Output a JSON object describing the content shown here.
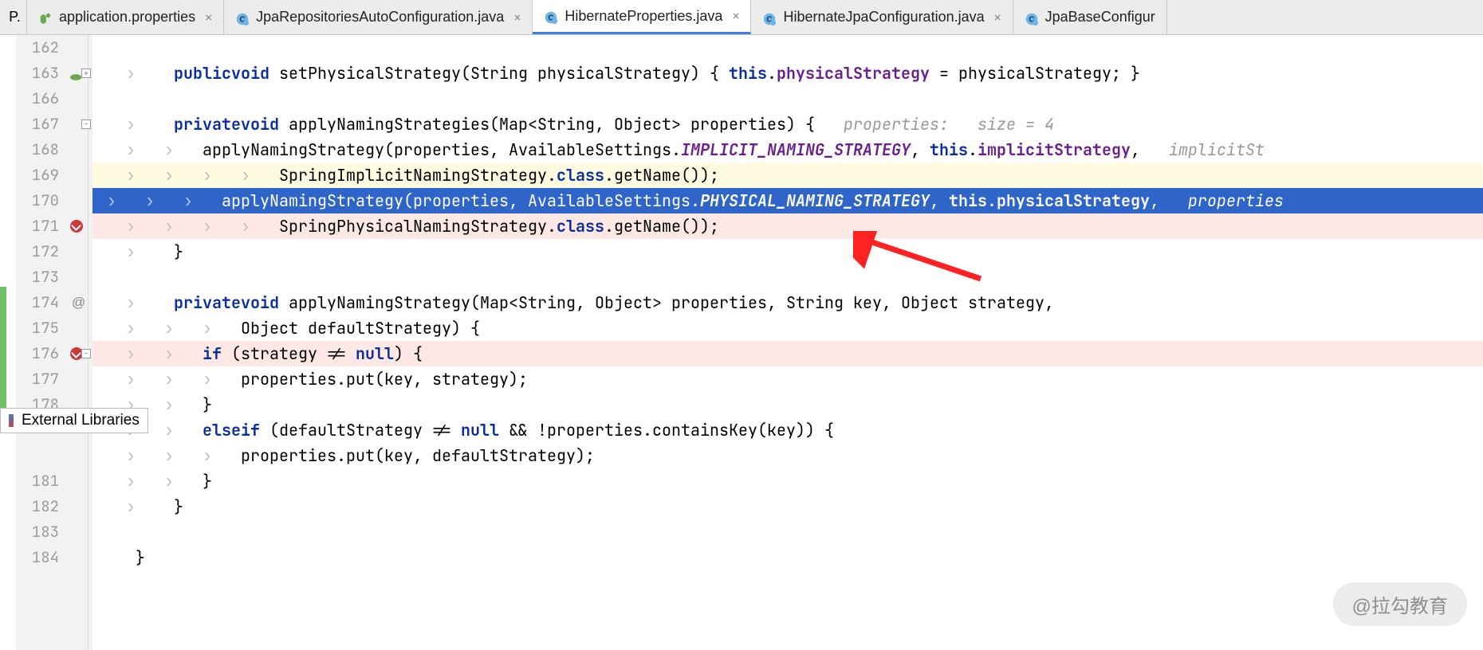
{
  "prefix": "P.",
  "tabs": [
    {
      "label": "application.properties",
      "icon": "props",
      "active": false
    },
    {
      "label": "JpaRepositoriesAutoConfiguration.java",
      "icon": "class",
      "active": false
    },
    {
      "label": "HibernateProperties.java",
      "icon": "class",
      "active": true
    },
    {
      "label": "HibernateJpaConfiguration.java",
      "icon": "class",
      "active": false
    },
    {
      "label": "JpaBaseConfigur",
      "icon": "class",
      "active": false,
      "truncated": true
    }
  ],
  "external_libraries_label": "External Libraries",
  "watermark": "@拉勾教育",
  "gutter_lines": [
    "162",
    "163",
    "166",
    "167",
    "168",
    "169",
    "170",
    "171",
    "172",
    "173",
    "174",
    "175",
    "176",
    "177",
    "178",
    "",
    "",
    "181",
    "182",
    "183",
    "184"
  ],
  "gutter_marks": {
    "1": "spring-fold",
    "3": "fold-open",
    "7": "breakpoint",
    "10": "at",
    "12": "breakpoint-fold"
  },
  "code_lines": [
    {
      "cls": "",
      "html": ""
    },
    {
      "cls": "",
      "html": "<span class='chev'>   ›    </span><span class='kw'>public</span> <span class='kw'>void</span> setPhysicalStrategy(String physicalStrategy) { <span class='kw'>this</span>.<span class='field'>physicalStrategy</span> = physicalStrategy; }"
    },
    {
      "cls": "",
      "html": ""
    },
    {
      "cls": "",
      "html": "<span class='chev'>   ›    </span><span class='kw'>private</span> <span class='kw'>void</span> applyNamingStrategies(Map&lt;String, Object&gt; properties) {   <span class='hint'>properties:   size = 4</span>"
    },
    {
      "cls": "",
      "html": "<span class='chev'>   ›   ›   </span>applyNamingStrategy(properties, AvailableSettings.<span class='const'>IMPLICIT_NAMING_STRATEGY</span>, <span class='kw'>this</span>.<span class='field'>implicitStrategy</span>,   <span class='hint'>implicitSt</span>"
    },
    {
      "cls": "hl-yellow",
      "html": "<span class='chev'>   ›   ›   ›   ›   </span>SpringImplicitNamingStrategy.<span class='kw'>class</span>.getName());"
    },
    {
      "cls": "sel",
      "html": "<span class='chev'> ›   ›   ›   </span>applyNamingStrategy(properties, AvailableSettings.<span class='const'>PHYSICAL_NAMING_STRATEGY</span>, <span class='kw'>this</span>.<span class='field'>physicalStrategy</span>,   <span class='hint'>properties</span>"
    },
    {
      "cls": "hl-pink",
      "html": "<span class='chev'>   ›   ›   ›   ›   </span>SpringPhysicalNamingStrategy.<span class='kw'>class</span>.getName());"
    },
    {
      "cls": "",
      "html": "<span class='chev'>   ›    </span>}"
    },
    {
      "cls": "",
      "html": ""
    },
    {
      "cls": "",
      "html": "<span class='chev'>   ›    </span><span class='kw'>private</span> <span class='kw'>void</span> applyNamingStrategy(Map&lt;String, Object&gt; properties, String key, Object strategy,"
    },
    {
      "cls": "",
      "html": "<span class='chev'>   ›   ›   ›   </span>Object defaultStrategy) {"
    },
    {
      "cls": "hl-pink",
      "html": "<span class='chev'>   ›   ›   </span><span class='kw'>if</span> (strategy != <span class='kw'>null</span>) {"
    },
    {
      "cls": "",
      "html": "<span class='chev'>   ›   ›   ›   </span>properties.put(key, strategy);"
    },
    {
      "cls": "",
      "html": "<span class='chev'>   ›   ›   </span>}"
    },
    {
      "cls": "",
      "html": "<span class='chev'>   ›   ›   </span><span class='kw'>else</span> <span class='kw'>if</span> (defaultStrategy != <span class='kw'>null</span> && !properties.containsKey(key)) {"
    },
    {
      "cls": "",
      "html": "<span class='chev'>   ›   ›   ›   </span>properties.put(key, defaultStrategy);"
    },
    {
      "cls": "",
      "html": "<span class='chev'>   ›   ›   </span>}"
    },
    {
      "cls": "",
      "html": "<span class='chev'>   ›    </span>}"
    },
    {
      "cls": "",
      "html": ""
    },
    {
      "cls": "",
      "html": "<span class='chev'>    </span>}"
    }
  ]
}
